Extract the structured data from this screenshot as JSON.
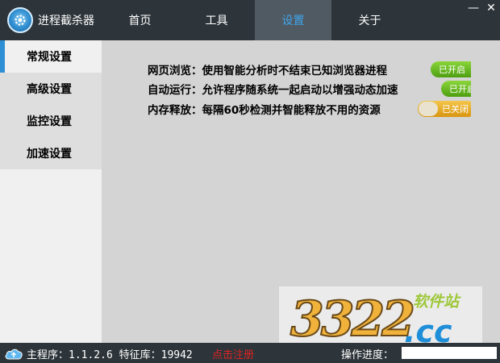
{
  "app": {
    "title": "进程截杀器"
  },
  "tabs": [
    {
      "label": "首页",
      "active": false
    },
    {
      "label": "工具",
      "active": false
    },
    {
      "label": "设置",
      "active": true
    },
    {
      "label": "关于",
      "active": false
    }
  ],
  "window_controls": {
    "minimize": "—",
    "close": "✕"
  },
  "sidebar": {
    "items": [
      {
        "label": "常规设置",
        "active": true
      },
      {
        "label": "高级设置",
        "active": false
      },
      {
        "label": "监控设置",
        "active": false
      },
      {
        "label": "加速设置",
        "active": false
      }
    ]
  },
  "settings": [
    {
      "label": "网页浏览",
      "description": "：使用智能分析时不结束已知浏览器进程",
      "toggle_text": "已开启",
      "enabled": true
    },
    {
      "label": "自动运行",
      "description": "：允许程序随系统一起启动以增强动态加速",
      "toggle_text": "已开启",
      "enabled": true
    },
    {
      "label": "内存释放",
      "description": "：每隔60秒检测并智能释放不用的资源",
      "toggle_text": "已关闭",
      "enabled": false
    }
  ],
  "watermark": {
    "number": "3322",
    "site_label": "软件站",
    "domain": ".cc"
  },
  "statusbar": {
    "program_label": "主程序：1.1.2.6",
    "db_label": "特征库：19942",
    "register_link": "点击注册",
    "progress_label": "操作进度：",
    "progress": 0
  },
  "colors": {
    "titlebar": "#2e353a",
    "active_tab": "#505a62",
    "accent": "#3fa5ec",
    "toggle_on": "#5fb21f",
    "toggle_off": "#e8a820"
  }
}
